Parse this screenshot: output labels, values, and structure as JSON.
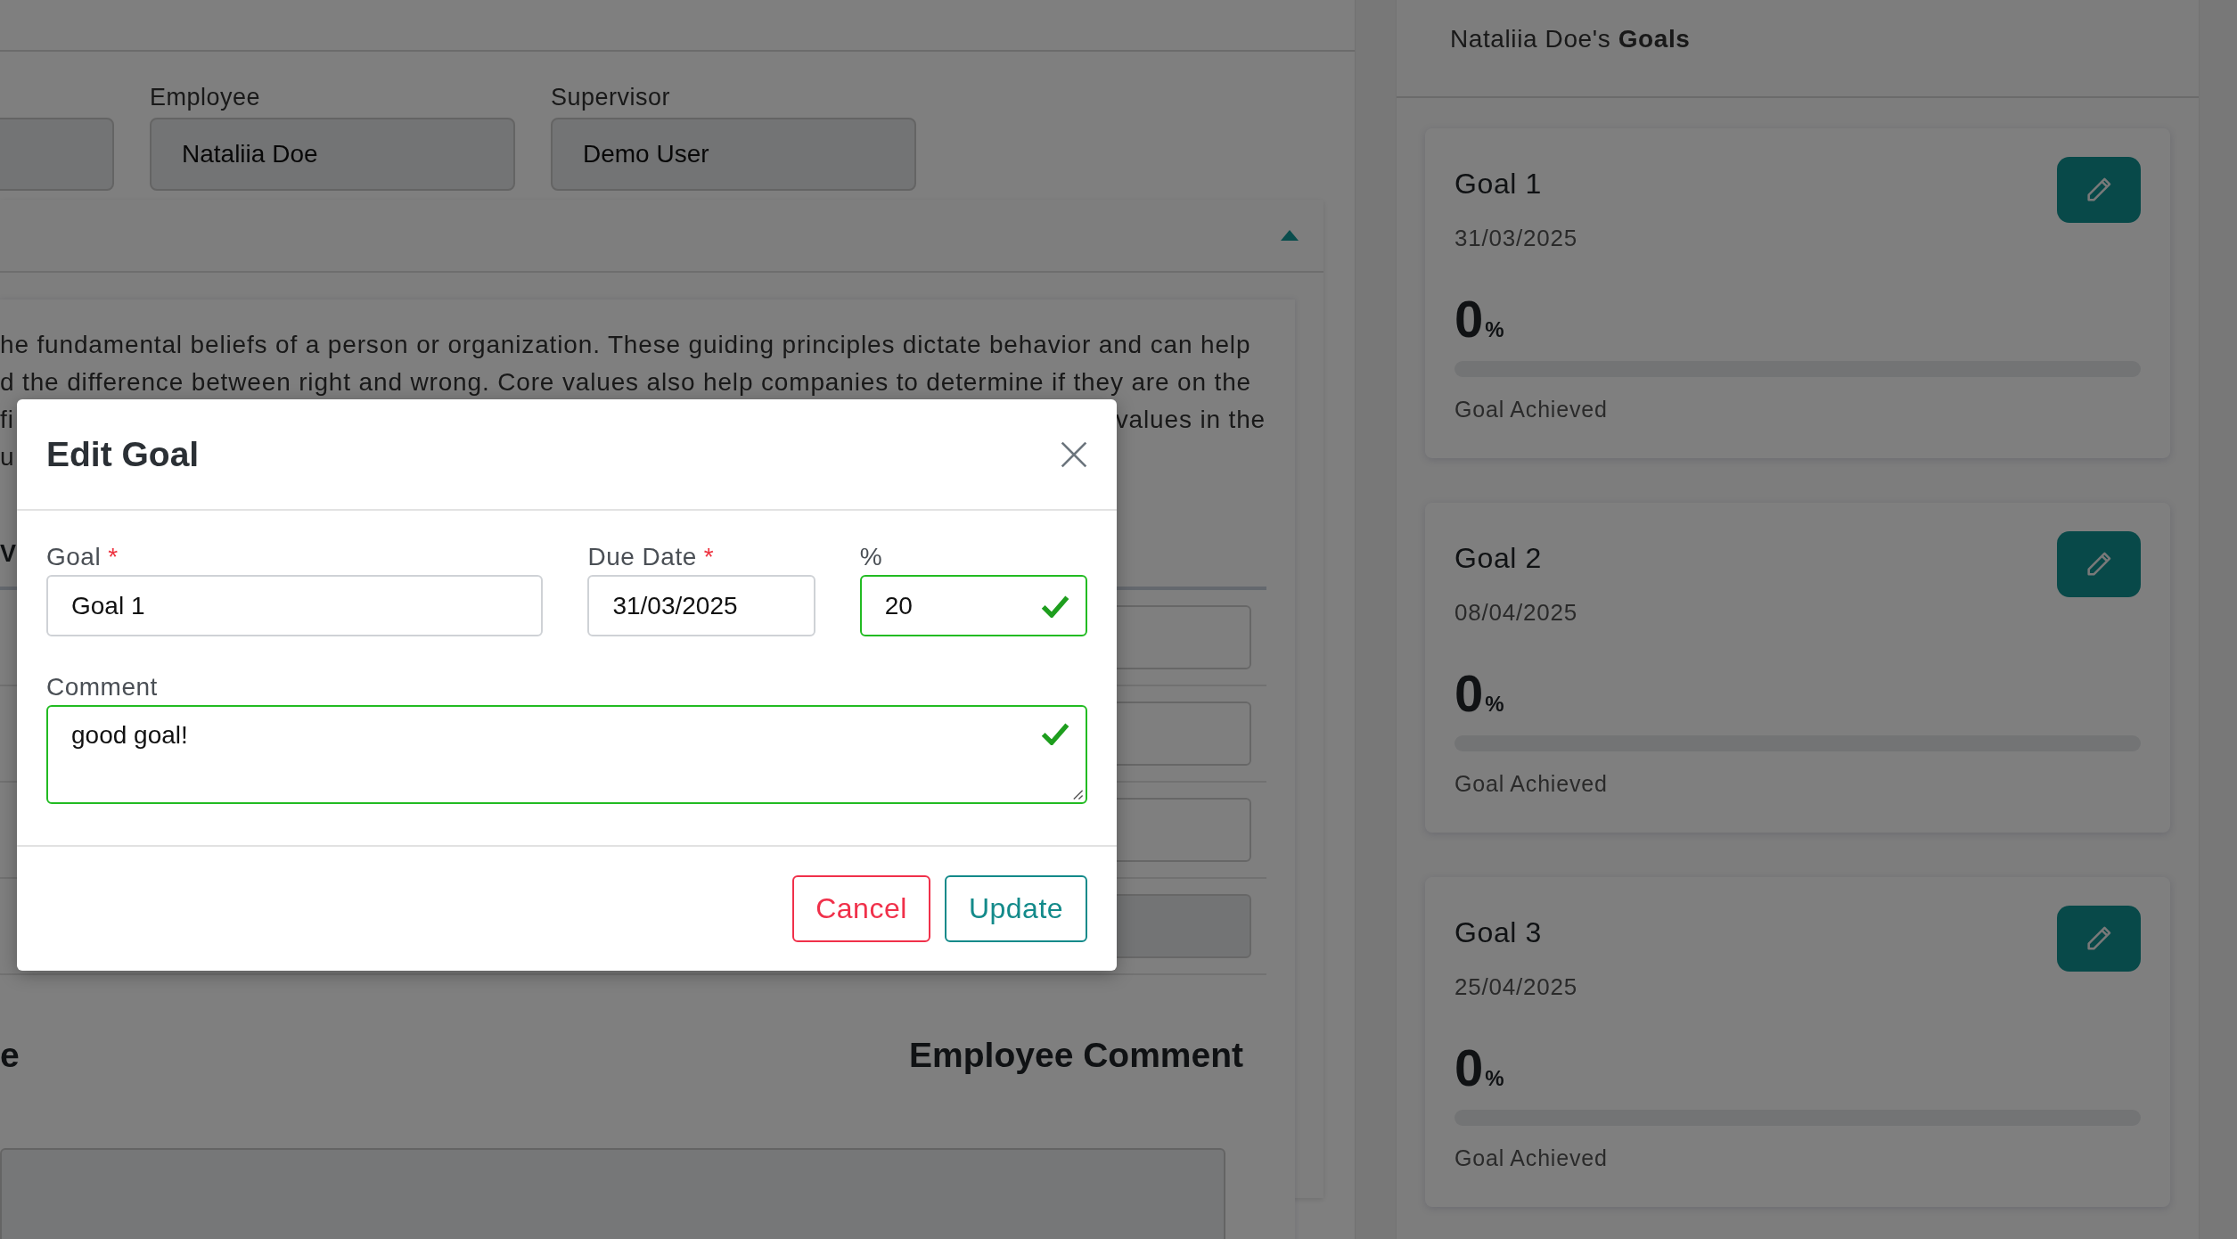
{
  "header_fields": [
    {
      "label": "Employee",
      "value": "Nataliia Doe"
    },
    {
      "label": "Supervisor",
      "value": "Demo User"
    }
  ],
  "section": {
    "expanded": true,
    "paragraph_lines": [
      {
        "left": "he fundamental beliefs of a person or organization. These guiding principles dictate behavior and can help"
      },
      {
        "left": "d the difference between right and wrong. Core values also help companies to determine if they are on the"
      },
      {
        "left": "fi",
        "right": "values in the"
      },
      {
        "left": "u"
      }
    ],
    "subheading": "V",
    "headings": [
      "e",
      "Employee Comment"
    ]
  },
  "goals_panel": {
    "title": "Nataliia Doe's **Goals**",
    "goals": [
      {
        "title": "Goal 1",
        "due_date": "31/03/2025",
        "percent": "0",
        "unit": "%",
        "level": 0,
        "caption": "Goal Achieved"
      },
      {
        "title": "Goal 2",
        "due_date": "08/04/2025",
        "percent": "0",
        "unit": "%",
        "level": 0,
        "caption": "Goal Achieved"
      },
      {
        "title": "Goal 3",
        "due_date": "25/04/2025",
        "percent": "0",
        "unit": "%",
        "level": 0,
        "caption": "Goal Achieved"
      }
    ]
  },
  "modal": {
    "title": "Edit Goal",
    "fields": [
      {
        "label": "Goal",
        "required_mark": "*",
        "value": "Goal 1",
        "valid": false
      },
      {
        "label": "Due Date",
        "required_mark": "*",
        "value": "31/03/2025",
        "valid": false
      },
      {
        "label": "%",
        "value": "20",
        "valid": true
      }
    ],
    "comment": {
      "label": "Comment",
      "value": "good goal!",
      "valid": true
    },
    "buttons": [
      {
        "label": "Cancel",
        "kind": "cancel"
      },
      {
        "label": "Update",
        "kind": "primary"
      }
    ]
  }
}
